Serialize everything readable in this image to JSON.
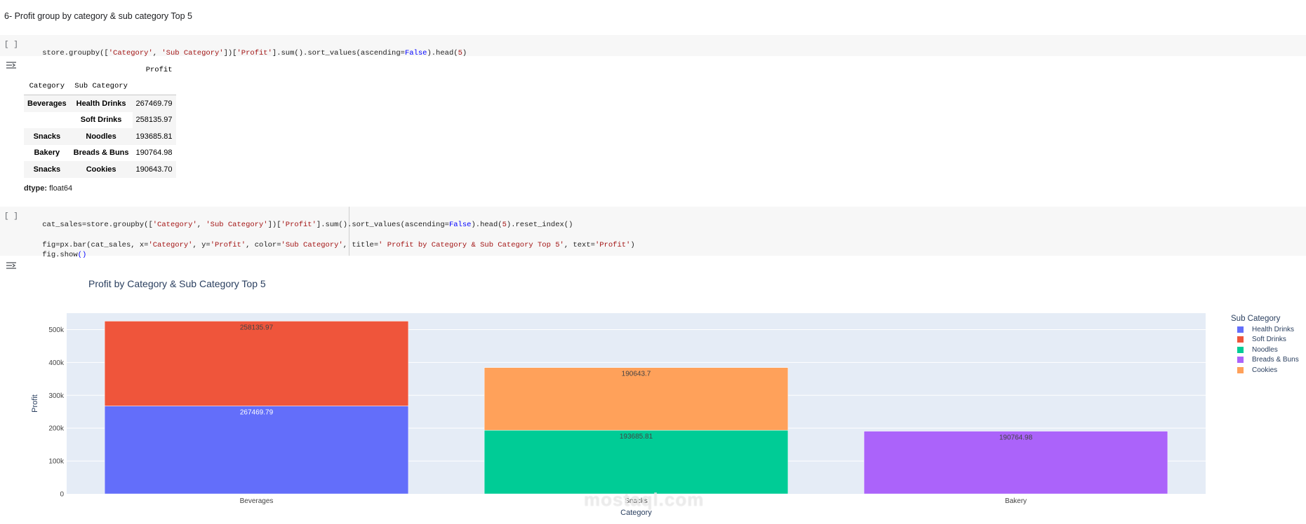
{
  "notebook": {
    "heading": "6- Profit group by category & sub category Top 5",
    "cell_prompt": "[ ]",
    "cell1": {
      "parts": [
        "store.groupby([",
        "'Category'",
        ", ",
        "'Sub Category'",
        "])[",
        "'Profit'",
        "].sum().sort_values(ascending=",
        "False",
        ").head(",
        "5",
        ")"
      ]
    },
    "cell2": {
      "line1_parts": [
        "cat_sales=store.groupby([",
        "'Category'",
        ", ",
        "'Sub Category'",
        "])[",
        "'Profit'",
        "].sum().sort_values(ascending=",
        "False",
        ").head(",
        "5",
        ").reset_index()"
      ],
      "line2_parts": [
        "fig=px.bar(cat_sales, x=",
        "'Category'",
        ", y=",
        "'Profit'",
        ", color=",
        "'Sub Category'",
        ", title=",
        "' Profit by Category & Sub Category Top 5'",
        ", text=",
        "'Profit'",
        ")"
      ],
      "line3_parts": [
        "fig.show",
        "()"
      ]
    },
    "output_table": {
      "value_header": "Profit",
      "index_headers": [
        "Category",
        "Sub Category"
      ],
      "rows": [
        {
          "category": "Beverages",
          "sub": "Health Drinks",
          "profit": "267469.79"
        },
        {
          "category": "",
          "sub": "Soft Drinks",
          "profit": "258135.97"
        },
        {
          "category": "Snacks",
          "sub": "Noodles",
          "profit": "193685.81"
        },
        {
          "category": "Bakery",
          "sub": "Breads & Buns",
          "profit": "190764.98"
        },
        {
          "category": "Snacks",
          "sub": "Cookies",
          "profit": "190643.70"
        }
      ],
      "dtype_label": "dtype:",
      "dtype_value": "float64"
    }
  },
  "chart_data": {
    "type": "bar",
    "title": "Profit by Category & Sub Category Top 5",
    "xlabel": "Category",
    "ylabel": "Profit",
    "categories": [
      "Beverages",
      "Snacks",
      "Bakery"
    ],
    "ylim": [
      0,
      550000
    ],
    "yticks": [
      0,
      100000,
      200000,
      300000,
      400000,
      500000
    ],
    "ytick_labels": [
      "0",
      "100k",
      "200k",
      "300k",
      "400k",
      "500k"
    ],
    "stacked": true,
    "grid": true,
    "legend_title": "Sub Category",
    "legend_position": "right",
    "series": [
      {
        "name": "Health Drinks",
        "color": "#636efa",
        "values": [
          267469.79,
          null,
          null
        ],
        "labels": [
          "267469.79",
          "",
          ""
        ],
        "label_color": "#ffffff"
      },
      {
        "name": "Soft Drinks",
        "color": "#ef553b",
        "values": [
          258135.97,
          null,
          null
        ],
        "labels": [
          "258135.97",
          "",
          ""
        ],
        "label_color": "#444444"
      },
      {
        "name": "Noodles",
        "color": "#00cc96",
        "values": [
          null,
          193685.81,
          null
        ],
        "labels": [
          "",
          "193685.81",
          ""
        ],
        "label_color": "#444444"
      },
      {
        "name": "Breads & Buns",
        "color": "#ab63fa",
        "values": [
          null,
          null,
          190764.98
        ],
        "labels": [
          "",
          "",
          "190764.98"
        ],
        "label_color": "#444444"
      },
      {
        "name": "Cookies",
        "color": "#ffa15a",
        "values": [
          null,
          190643.7,
          null
        ],
        "labels": [
          "",
          "190643.7",
          ""
        ],
        "label_color": "#444444"
      }
    ]
  },
  "watermark": "mostaql.com",
  "colors": {
    "plot_bg": "#e5ecf6",
    "axis_text": "#444444",
    "title": "#2a3f5f"
  }
}
